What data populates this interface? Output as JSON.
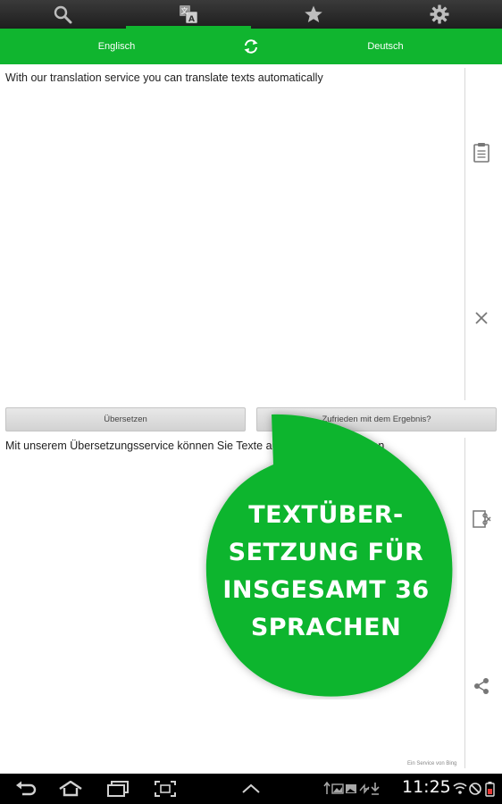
{
  "tabs": [
    {
      "icon": "search-icon"
    },
    {
      "icon": "translate-icon",
      "active": true
    },
    {
      "icon": "star-icon"
    },
    {
      "icon": "gear-icon"
    }
  ],
  "languages": {
    "source": "Englisch",
    "target": "Deutsch",
    "swap_icon": "swap-arrows-icon"
  },
  "source_text": "With our translation service you can translate texts automatically",
  "buttons": {
    "translate": "Übersetzen",
    "feedback": "Zufrieden mit dem Ergebnis?"
  },
  "result_text": "Mit unserem Übersetzungsservice können Sie Texte automatisch übersetzen",
  "credit": "Ein Service von Bing",
  "promo": {
    "line1": "TEXTÜBER-",
    "line2": "SETZUNG FÜR",
    "line3": "INSGESAMT 36",
    "line4": "SPRACHEN",
    "color": "#10b52f"
  },
  "system_bar": {
    "time": "11:25"
  },
  "colors": {
    "accent": "#10b52f",
    "topbar": "#2a2a2a"
  }
}
